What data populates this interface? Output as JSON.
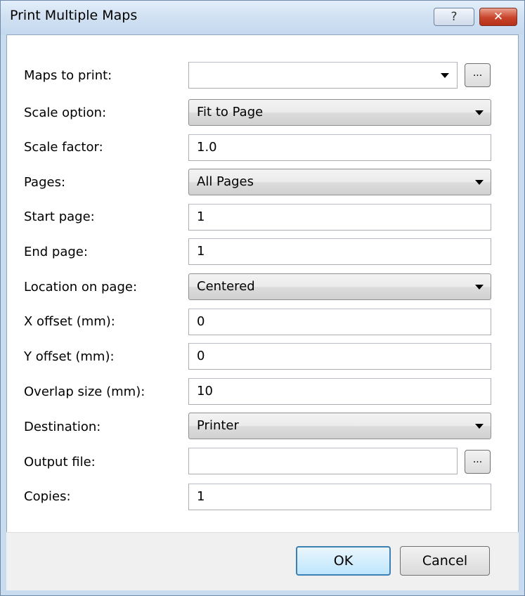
{
  "window": {
    "title": "Print Multiple Maps",
    "help_glyph": "?",
    "close_glyph": "✕"
  },
  "form": {
    "maps_to_print": {
      "label": "Maps to print:",
      "value": ""
    },
    "browse_maps_label": "...",
    "scale_option": {
      "label": "Scale option:",
      "value": "Fit to Page"
    },
    "scale_factor": {
      "label": "Scale factor:",
      "value": "1.0"
    },
    "pages": {
      "label": "Pages:",
      "value": "All Pages"
    },
    "start_page": {
      "label": "Start page:",
      "value": "1"
    },
    "end_page": {
      "label": "End page:",
      "value": "1"
    },
    "location_on_page": {
      "label": "Location on page:",
      "value": "Centered"
    },
    "x_offset": {
      "label": "X offset (mm):",
      "value": "0"
    },
    "y_offset": {
      "label": "Y offset (mm):",
      "value": "0"
    },
    "overlap_size": {
      "label": "Overlap size (mm):",
      "value": "10"
    },
    "destination": {
      "label": "Destination:",
      "value": "Printer"
    },
    "output_file": {
      "label": "Output file:",
      "value": ""
    },
    "browse_output_label": "...",
    "copies": {
      "label": "Copies:",
      "value": "1"
    }
  },
  "buttons": {
    "ok": "OK",
    "cancel": "Cancel"
  },
  "icons": {
    "help": "help-icon",
    "close": "close-icon",
    "dropdown": "chevron-down-icon"
  }
}
